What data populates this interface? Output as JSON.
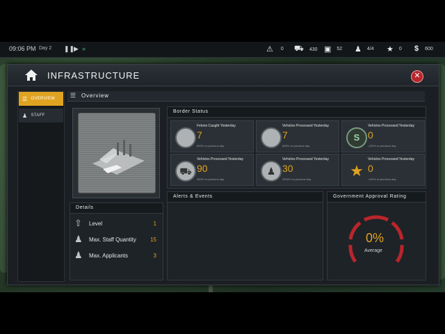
{
  "topbar": {
    "time": "09:06 PM",
    "day": "Day 2",
    "stats": [
      {
        "icon": "warning-icon",
        "value": "0"
      },
      {
        "icon": "car-icon",
        "value": "430"
      },
      {
        "icon": "ticket-icon",
        "value": "52"
      },
      {
        "icon": "people-icon",
        "value": "4/4"
      },
      {
        "icon": "star-icon",
        "value": "0"
      },
      {
        "icon": "dollar-icon",
        "value": "600"
      }
    ]
  },
  "window": {
    "title": "INFRASTRUCTURE"
  },
  "sidebar": {
    "items": [
      {
        "label": "OVERVIEW",
        "active": true
      },
      {
        "label": "STAFF",
        "active": false
      }
    ]
  },
  "main": {
    "section_title": "Overview"
  },
  "details": {
    "title": "Details",
    "rows": [
      {
        "label": "Level",
        "value": "1"
      },
      {
        "label": "Max. Staff Quantity",
        "value": "15"
      },
      {
        "label": "Max. Applicants",
        "value": "3"
      }
    ]
  },
  "border_status": {
    "title": "Border Status",
    "tiles": [
      {
        "label": "Felons Caught Yesterday",
        "value": "7",
        "sub": "600% vs previous day",
        "icon": "felon-check-icon"
      },
      {
        "label": "Vehicles Processed Yesterday",
        "value": "7",
        "sub": "600% vs previous day",
        "icon": "felon-cancel-icon"
      },
      {
        "label": "Vehicles Processed Yesterday",
        "value": "0",
        "sub": "-100% vs previous day",
        "icon": "money-icon"
      },
      {
        "label": "Vehicles Processed Yesterday",
        "value": "90",
        "sub": "960% vs previous day",
        "icon": "car-check-icon"
      },
      {
        "label": "Vehicles Processed Yesterday",
        "value": "30",
        "sub": "2900% vs previous day",
        "icon": "people-check-icon"
      },
      {
        "label": "Vehicles Processed Yesterday",
        "value": "0",
        "sub": "-100% vs previous day",
        "icon": "star-icon"
      }
    ]
  },
  "alerts": {
    "title": "Alerts & Events"
  },
  "approval": {
    "title": "Government Approval Rating",
    "value": "0%",
    "caption": "Average"
  },
  "colors": {
    "accent": "#e0a321",
    "close": "#b8262b",
    "gauge": "#b8262b"
  }
}
